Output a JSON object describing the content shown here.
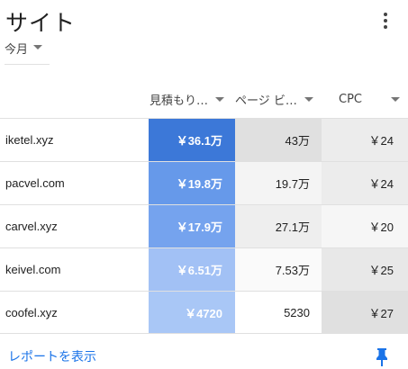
{
  "card": {
    "title": "サイト"
  },
  "period": {
    "label": "今月"
  },
  "columns": {
    "estimate": "見積もり…",
    "pageviews": "ページ ビ…",
    "cpc": "CPC"
  },
  "rows": [
    {
      "site": "iketel.xyz",
      "estimate": "￥36.1万",
      "pageviews": "43万",
      "cpc": "￥24",
      "est_color": "#3c78d8",
      "pv_color": "#e0e0e0",
      "cpc_color": "#ececec"
    },
    {
      "site": "pacvel.com",
      "estimate": "￥19.8万",
      "pageviews": "19.7万",
      "cpc": "￥24",
      "est_color": "#6699ea",
      "pv_color": "#f4f4f4",
      "cpc_color": "#ececec"
    },
    {
      "site": "carvel.xyz",
      "estimate": "￥17.9万",
      "pageviews": "27.1万",
      "cpc": "￥20",
      "est_color": "#75a3ee",
      "pv_color": "#eeeeee",
      "cpc_color": "#f6f6f6"
    },
    {
      "site": "keivel.com",
      "estimate": "￥6.51万",
      "pageviews": "7.53万",
      "cpc": "￥25",
      "est_color": "#a2c1f5",
      "pv_color": "#fafafa",
      "cpc_color": "#e8e8e8"
    },
    {
      "site": "coofel.xyz",
      "estimate": "￥4720",
      "pageviews": "5230",
      "cpc": "￥27",
      "est_color": "#a9c7f6",
      "pv_color": "#ffffff",
      "cpc_color": "#e0e0e0"
    }
  ],
  "footer": {
    "report_link": "レポートを表示"
  },
  "colors": {
    "link": "#1a73e8",
    "pin": "#1a73e8"
  },
  "icons": {
    "menu": "more-vert-icon",
    "pin": "pin-icon",
    "sort": "caret-down-icon"
  }
}
